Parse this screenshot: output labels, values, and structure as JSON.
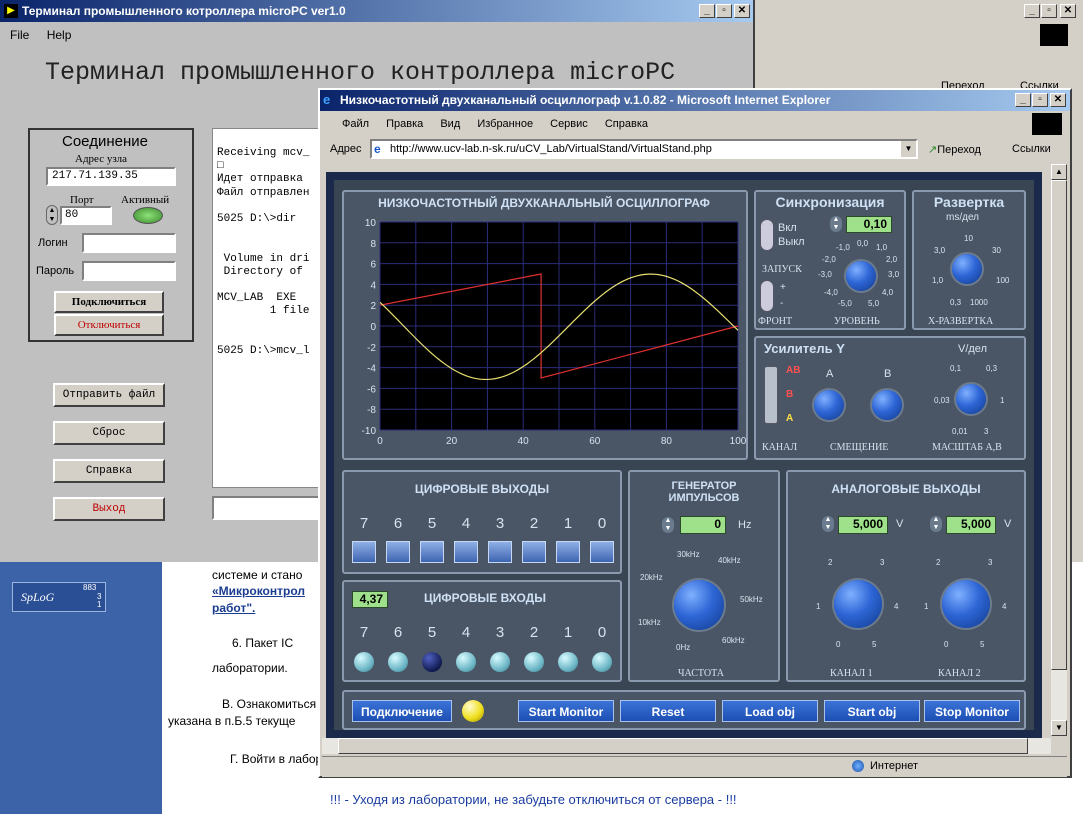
{
  "terminal": {
    "window_title": "Терминал промышленного котроллера microPC ver1.0",
    "menu": [
      "File",
      "Help"
    ],
    "heading": "Терминал промышленного контроллера microPC",
    "connection": {
      "title": "Соединение",
      "address_label": "Адрес узла",
      "address_value": "217.71.139.35",
      "port_label": "Порт",
      "active_label": "Активный",
      "port_value": "80",
      "login_label": "Логин",
      "password_label": "Пароль",
      "connect_button": "Подключиться",
      "disconnect_button": "Отключиться"
    },
    "buttons": {
      "send_file": "Отправить файл",
      "reset": "Сброс",
      "help": "Справка",
      "exit": "Выход"
    },
    "console_lines": [
      "Receiving mcv_",
      "□",
      "Идет отправка",
      "Файл отправлен",
      "",
      "5025 D:\\>dir",
      "",
      "",
      " Volume in dri",
      " Directory of",
      "",
      "MCV_LAB  EXE",
      "        1 file",
      "",
      "",
      "5025 D:\\>mcv_l"
    ]
  },
  "behind_browser": {
    "go_label": "Переход",
    "links_label": "Ссылки",
    "logo_text": "SpLoG",
    "logo_numbers": [
      "883",
      "3",
      "1"
    ],
    "page_lines": [
      "системе и стано",
      "«Микроконтрол",
      "работ\".",
      "6.  Пакет  IC",
      "лаборатории.",
      "В. Ознакомиться",
      "указана в п.Б.5 текуще",
      "Г. Войти в лабор"
    ],
    "warning": "!!! - Уходя из лаборатории, не забудьте отключиться от сервера - !!!"
  },
  "ie": {
    "window_title": "Низкочастотный двухканальный осциллограф v.1.0.82 - Microsoft Internet Explorer",
    "menu": [
      "Файл",
      "Правка",
      "Вид",
      "Избранное",
      "Сервис",
      "Справка"
    ],
    "address_label": "Адрес",
    "url": "http://www.ucv-lab.n-sk.ru/uCV_Lab/VirtualStand/VirtualStand.php",
    "go_label": "Переход",
    "links_label": "Ссылки",
    "status_zone": "Интернет"
  },
  "scope": {
    "title": "НИЗКОЧАСТОТНЫЙ ДВУХКАНАЛЬНЫЙ ОСЦИЛЛОГРАФ",
    "y_ticks": [
      "10",
      "8",
      "6",
      "4",
      "2",
      "0",
      "-2",
      "-4",
      "-6",
      "-8",
      "-10"
    ],
    "x_ticks": [
      "0",
      "20",
      "40",
      "60",
      "80",
      "100"
    ],
    "sync": {
      "title": "Синхронизация",
      "on": "Вкл",
      "off": "Выкл",
      "level_value": "0,10",
      "start": "ЗАПУСК",
      "front": "ФРОНТ",
      "level": "УРОВЕНЬ",
      "plus": "+",
      "minus": "-",
      "scale": [
        "-1,0",
        "0,0",
        "1,0",
        "-2,0",
        "2,0",
        "-3,0",
        "3,0",
        "-4,0",
        "4,0",
        "-5,0",
        "5,0"
      ]
    },
    "sweep": {
      "title": "Развертка",
      "unit": "ms/дел",
      "scale": [
        "10",
        "3,0",
        "30",
        "1,0",
        "100",
        "0,3",
        "1000"
      ],
      "label": "X-РАЗВЕРТКА"
    },
    "amp": {
      "title": "Усилитель Y",
      "unit": "V/дел",
      "channel_options": [
        "AB",
        "B",
        "A"
      ],
      "a": "A",
      "b": "B",
      "scale": [
        "0,1",
        "0,3",
        "0,03",
        "1",
        "0,01",
        "3"
      ],
      "channel": "КАНАЛ",
      "offset": "СМЕЩЕНИЕ",
      "scale_label": "МАСШТАБ А,В"
    },
    "dout": {
      "title": "ЦИФРОВЫЕ ВЫХОДЫ",
      "bits": [
        "7",
        "6",
        "5",
        "4",
        "3",
        "2",
        "1",
        "0"
      ]
    },
    "din": {
      "title": "ЦИФРОВЫЕ ВХОДЫ",
      "value": "4,37",
      "bits": [
        "7",
        "6",
        "5",
        "4",
        "3",
        "2",
        "1",
        "0"
      ]
    },
    "gen": {
      "title1": "ГЕНЕРАТОР",
      "title2": "ИМПУЛЬСОВ",
      "value": "0",
      "unit": "Hz",
      "scale": [
        "30kHz",
        "40kHz",
        "20kHz",
        "50kHz",
        "10kHz",
        "60kHz",
        "0Hz"
      ],
      "label": "ЧАСТОТА"
    },
    "aout": {
      "title": "АНАЛОГОВЫЕ ВЫХОДЫ",
      "ch1_value": "5,000",
      "ch2_value": "5,000",
      "unit": "V",
      "scale": [
        "2",
        "3",
        "1",
        "4",
        "0",
        "5"
      ],
      "ch1": "КАНАЛ 1",
      "ch2": "КАНАЛ 2"
    },
    "buttons": {
      "connect": "Подключение",
      "start_monitor": "Start Monitor",
      "reset": "Reset",
      "load_obj": "Load obj",
      "start_obj": "Start obj",
      "stop_monitor": "Stop Monitor"
    }
  },
  "colors": {
    "scope_bg": "#4a5665",
    "trace_red": "#e03030",
    "trace_yellow": "#e8e070",
    "title_blue": "#0a246a"
  }
}
